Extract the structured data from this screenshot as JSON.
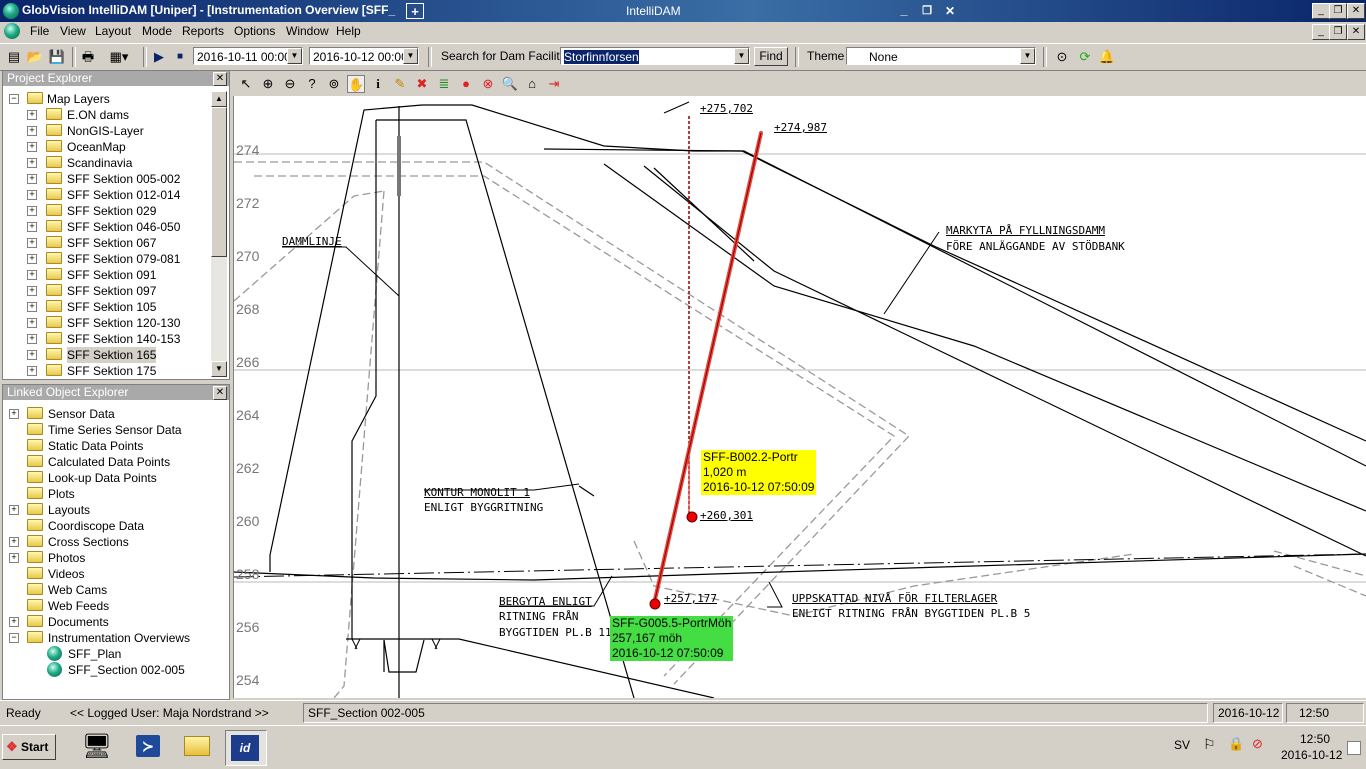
{
  "window": {
    "title": "GlobVision IntelliDAM [Uniper] - [Instrumentation Overview [SFF_",
    "center_title": "IntelliDAM",
    "minimize": "_",
    "restore": "❐",
    "close": "✕"
  },
  "menu": {
    "items": [
      "File",
      "View",
      "Layout",
      "Mode",
      "Reports",
      "Options",
      "Window",
      "Help"
    ]
  },
  "toolbar": {
    "date_from": "2016-10-11 00:00",
    "date_to": "2016-10-12 00:00",
    "search_label": "Search for Dam Facility",
    "search_value": "Storfinnforsen",
    "find_label": "Find",
    "theme_label": "Theme",
    "theme_value": "None"
  },
  "project_explorer": {
    "title": "Project Explorer",
    "root": "Map Layers",
    "items": [
      "E.ON dams",
      "NonGIS-Layer",
      "OceanMap",
      "Scandinavia",
      "SFF Sektion 005-002",
      "SFF Sektion 012-014",
      "SFF Sektion 029",
      "SFF Sektion 046-050",
      "SFF Sektion 067",
      "SFF Sektion 079-081",
      "SFF Sektion 091",
      "SFF Sektion 097",
      "SFF Sektion 105",
      "SFF Sektion 120-130",
      "SFF Sektion 140-153",
      "SFF Sektion 165",
      "SFF Sektion 175"
    ],
    "selected": "SFF Sektion 165"
  },
  "linked_explorer": {
    "title": "Linked Object Explorer",
    "items": [
      {
        "label": "Sensor Data",
        "exp": "+"
      },
      {
        "label": "Time Series Sensor Data",
        "exp": ""
      },
      {
        "label": "Static Data Points",
        "exp": ""
      },
      {
        "label": "Calculated Data Points",
        "exp": ""
      },
      {
        "label": "Look-up Data Points",
        "exp": ""
      },
      {
        "label": "Plots",
        "exp": ""
      },
      {
        "label": "Layouts",
        "exp": "+"
      },
      {
        "label": "Coordiscope Data",
        "exp": ""
      },
      {
        "label": "Cross Sections",
        "exp": "+"
      },
      {
        "label": "Photos",
        "exp": "+"
      },
      {
        "label": "Videos",
        "exp": ""
      },
      {
        "label": "Web Cams",
        "exp": ""
      },
      {
        "label": "Web Feeds",
        "exp": ""
      },
      {
        "label": "Documents",
        "exp": "+"
      },
      {
        "label": "Instrumentation Overviews",
        "exp": "−"
      }
    ],
    "children": [
      "SFF_Plan",
      "SFF_Section 002-005"
    ]
  },
  "map": {
    "y_ticks": [
      "274",
      "272",
      "270",
      "268",
      "266",
      "264",
      "262",
      "260",
      "258",
      "256",
      "254"
    ],
    "labels": {
      "elev_275": "+275,702",
      "elev_274": "+274,987",
      "elev_260": "+260,301",
      "elev_257": "+257,177",
      "damline": "DAMMLINJE",
      "markyta_1": "MARKYTA PÅ FYLLNINGSDAMM",
      "markyta_2": "FÖRE ANLÄGGANDE AV STÖDBANK",
      "kontur_1": "KONTUR MONOLIT 1",
      "kontur_2": "ENLIGT BYGGRITNING",
      "bergyta_1": "BERGYTA ENLIGT",
      "bergyta_2": "RITNING FRÅN",
      "bergyta_3": "BYGGTIDEN PL.B 11",
      "uppskattad_1": "UPPSKATTAD NIVÅ FÖR FILTERLAGER",
      "uppskattad_2": "ENLIGT RITNING FRÅN BYGGTIDEN PL.B 5"
    },
    "sensor_yellow": {
      "name": "SFF-B002.2-Portr",
      "value": "1,020 m",
      "time": "2016-10-12 07:50:09",
      "color": "#ffff00"
    },
    "sensor_green": {
      "name": "SFF-G005.5-PortrMöh",
      "value": "257,167 möh",
      "time": "2016-10-12 07:50:09",
      "color": "#44dd44"
    },
    "pipe_color": "#e8443a"
  },
  "status": {
    "ready": "Ready",
    "user": "<< Logged User: Maja Nordstrand >>",
    "view": "SFF_Section 002-005",
    "date": "2016-10-12",
    "time": "12:50"
  },
  "taskbar": {
    "start": "Start",
    "lang": "SV",
    "clock_time": "12:50",
    "clock_date": "2016-10-12"
  }
}
